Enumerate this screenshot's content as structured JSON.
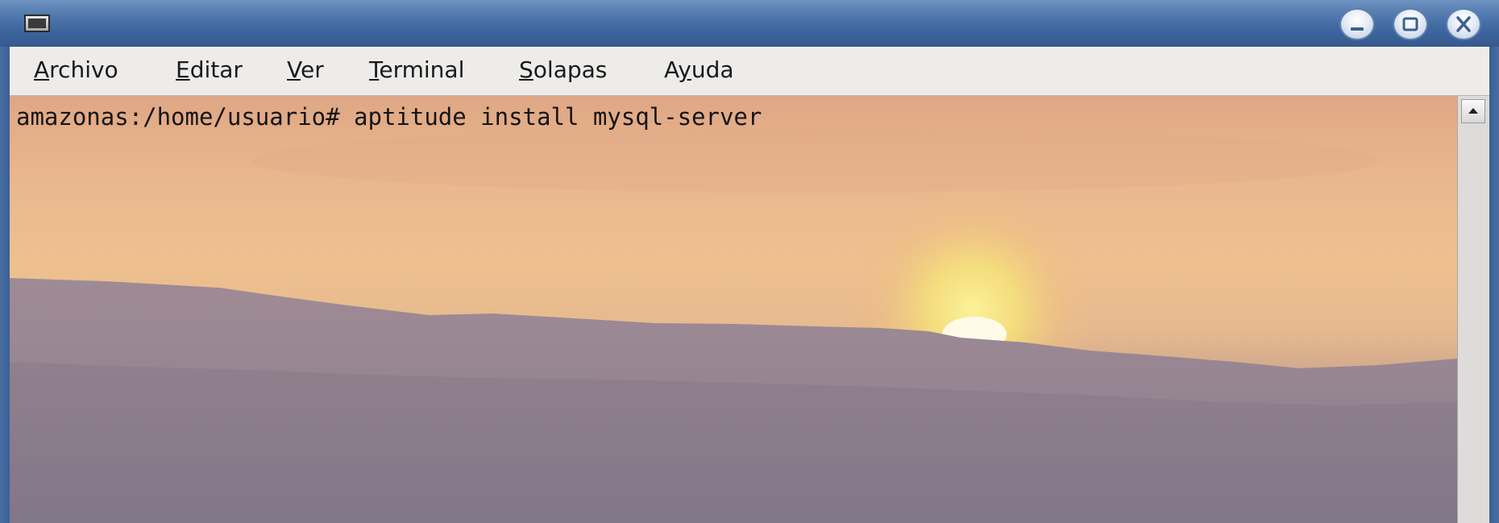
{
  "window": {
    "title_icon": "terminal-icon",
    "controls": [
      "minimize-icon",
      "maximize-icon",
      "close-icon"
    ]
  },
  "menubar": {
    "items": [
      {
        "accel": "A",
        "rest": "rchivo"
      },
      {
        "accel": "E",
        "rest": "ditar"
      },
      {
        "accel": "V",
        "rest": "er"
      },
      {
        "accel": "T",
        "rest": "erminal"
      },
      {
        "accel": "S",
        "rest": "olapas"
      },
      {
        "pre": "A",
        "accel": "y",
        "rest": "uda"
      }
    ]
  },
  "terminal": {
    "prompt_line": "amazonas:/home/usuario# aptitude install mysql-server"
  },
  "colors": {
    "titlebar": "#4f77ad",
    "menubar": "#edeceb",
    "text": "#151515"
  }
}
